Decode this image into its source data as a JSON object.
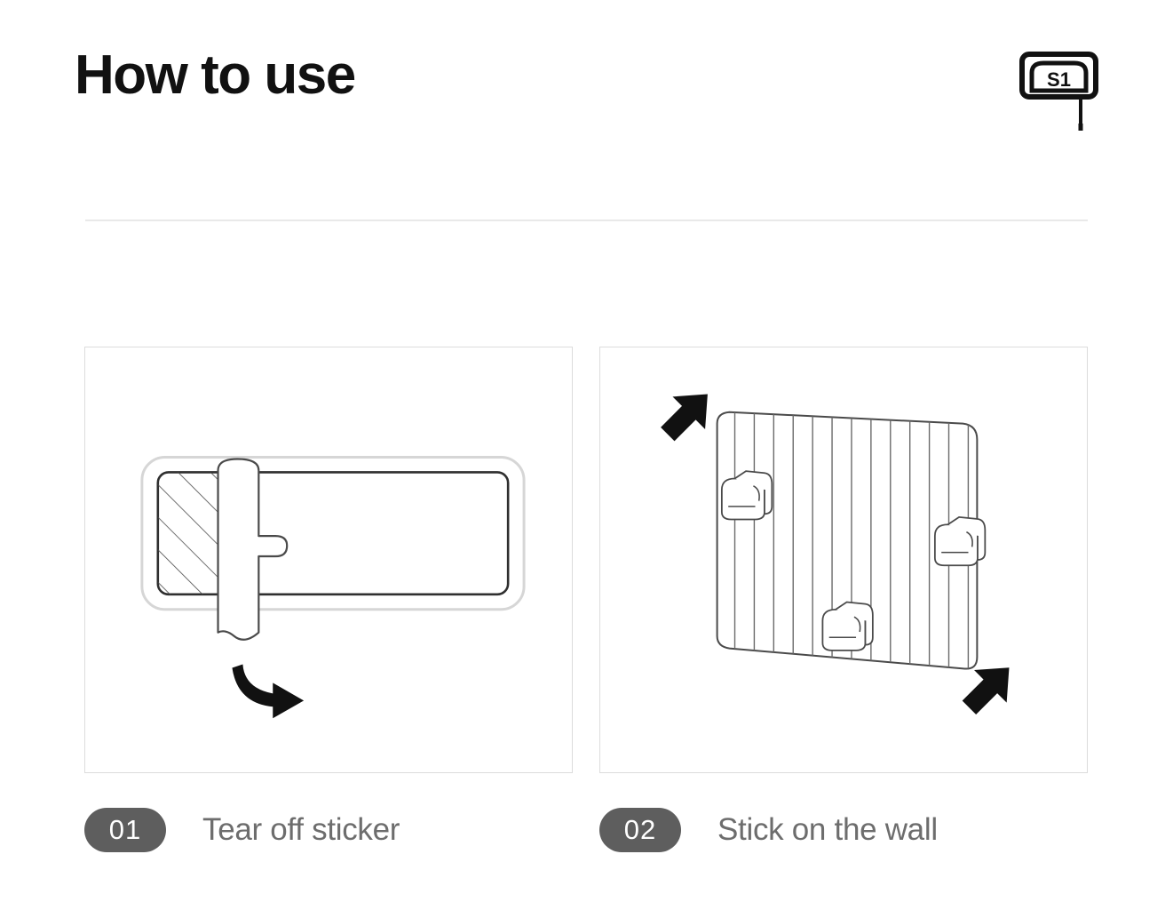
{
  "header": {
    "title": "How to use",
    "logo": {
      "icon": "s1-tag-icon",
      "label": "S1"
    }
  },
  "steps": [
    {
      "number": "01",
      "label": "Tear off sticker",
      "figure": {
        "icon": "peel-sticker-illustration",
        "elements": [
          "adhesive-pad-outline",
          "hatched-backing",
          "peel-tab",
          "curved-arrow-right"
        ]
      }
    },
    {
      "number": "02",
      "label": "Stick on the wall",
      "figure": {
        "icon": "wall-panel-illustration",
        "elements": [
          "striped-wall-panel",
          "hook-mount",
          "hook-mount",
          "hook-mount",
          "arrow-up-right",
          "arrow-up-right"
        ]
      }
    }
  ],
  "colors": {
    "title": "#111111",
    "caption_text": "#6d6d6d",
    "badge_bg": "#5e5e5e",
    "badge_text": "#ffffff",
    "divider": "#e9e9e9",
    "panel_border": "#dcdcdc",
    "line_art": "#3a3a3a",
    "arrow": "#111111"
  }
}
